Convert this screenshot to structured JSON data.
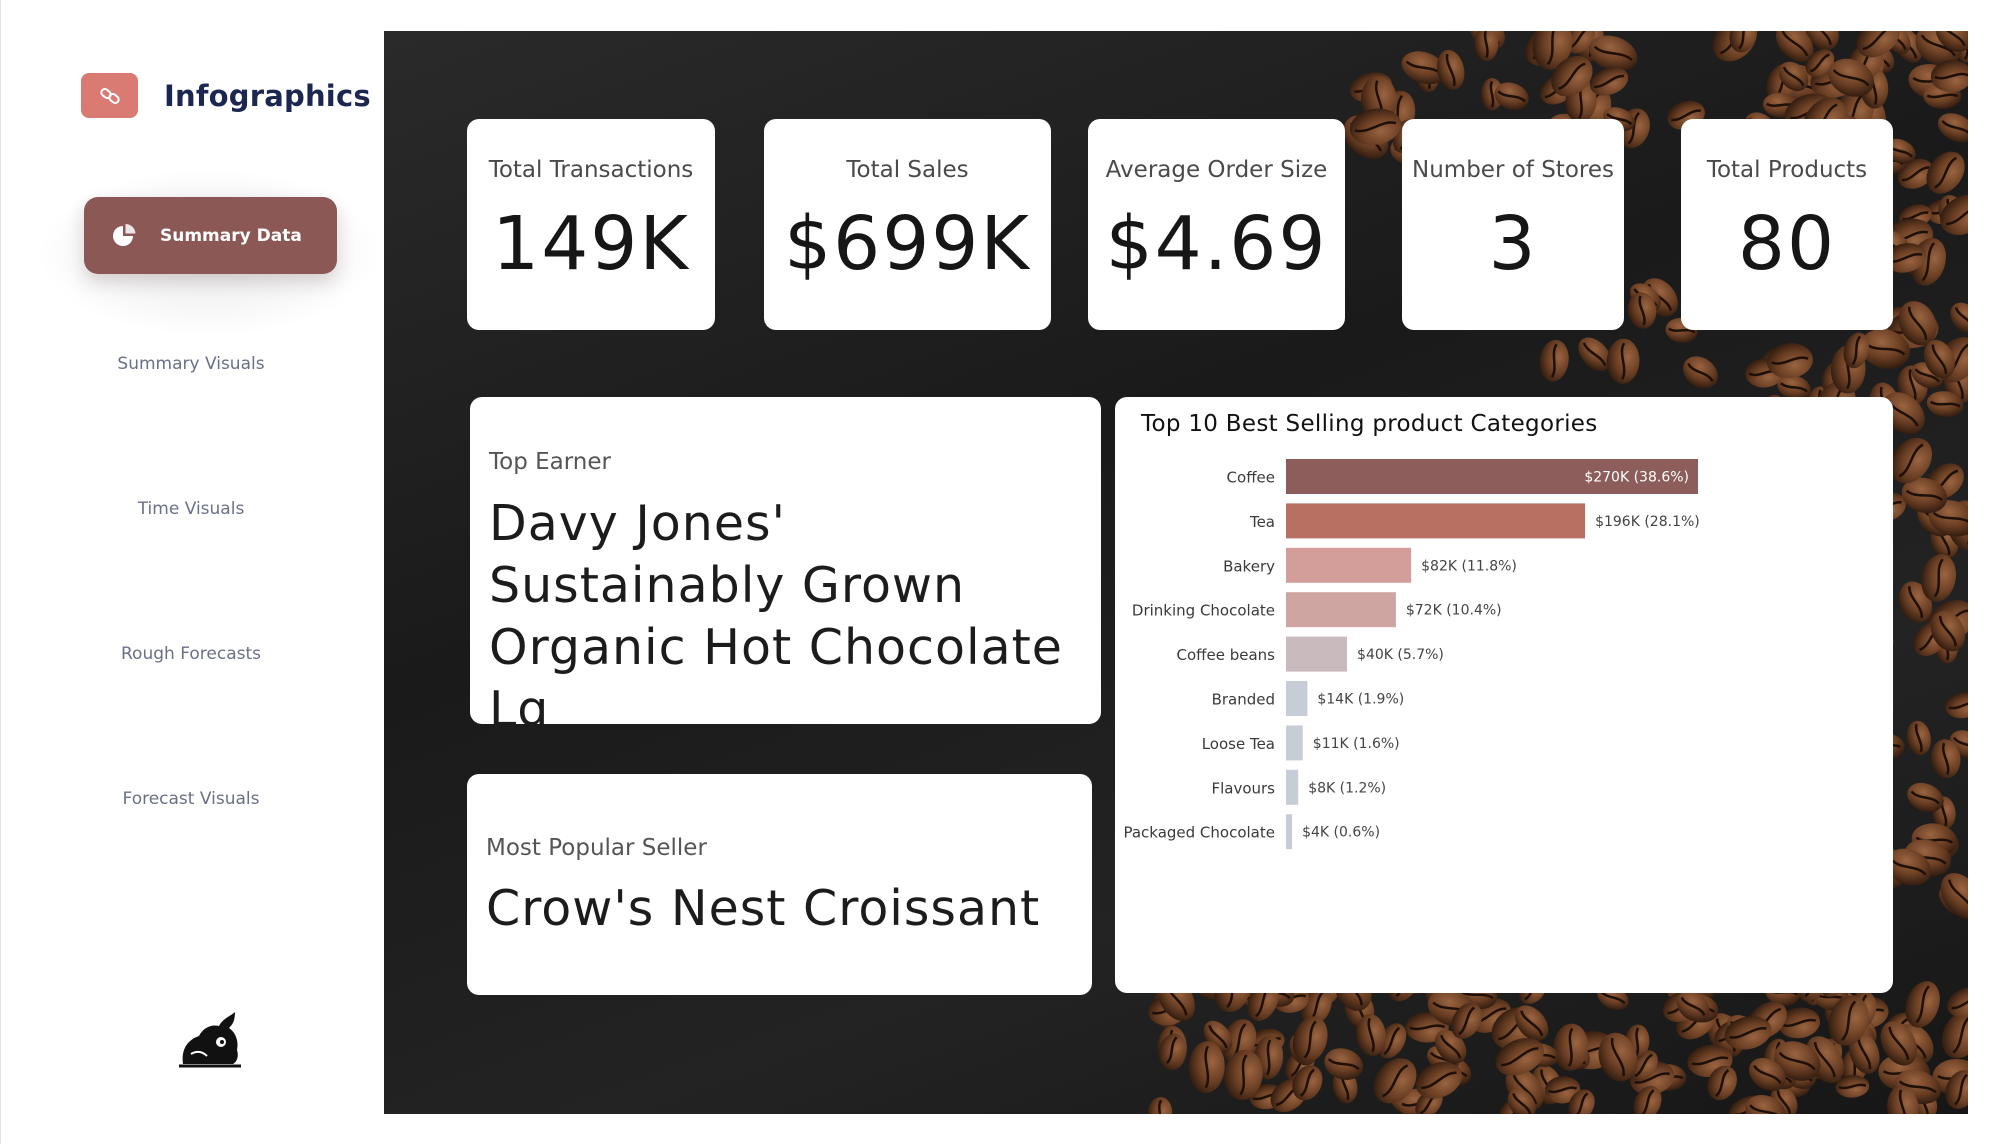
{
  "sidebar": {
    "brand": "Infographics",
    "nav": [
      {
        "label": "Summary Data",
        "active": true
      },
      {
        "label": "Summary Visuals",
        "active": false
      },
      {
        "label": "Time Visuals",
        "active": false
      },
      {
        "label": "Rough Forecasts",
        "active": false
      },
      {
        "label": "Forecast Visuals",
        "active": false
      }
    ]
  },
  "kpis": [
    {
      "label": "Total Transactions",
      "value": "149K"
    },
    {
      "label": "Total Sales",
      "value": "$699K"
    },
    {
      "label": "Average Order Size",
      "value": "$4.69"
    },
    {
      "label": "Number of Stores",
      "value": "3"
    },
    {
      "label": "Total Products",
      "value": "80"
    }
  ],
  "top_earner": {
    "label": "Top Earner",
    "value": "Davy Jones' Sustainably Grown Organic Hot Chocolate Lg"
  },
  "most_popular": {
    "label": "Most Popular Seller",
    "value": "Crow's Nest Croissant"
  },
  "colors": {
    "accent": "#8c5856",
    "brand_badge": "#d97a73",
    "nav_text": "#6a7186",
    "brand_text": "#1b2750"
  },
  "icons": {
    "brand": "link-icon",
    "active_nav": "pie-chart-icon",
    "mascot": "bull-mascot-icon"
  },
  "chart_data": {
    "type": "bar",
    "orientation": "horizontal",
    "title": "Top 10 Best Selling product Categories",
    "categories": [
      "Coffee",
      "Tea",
      "Bakery",
      "Drinking Chocolate",
      "Coffee beans",
      "Branded",
      "Loose Tea",
      "Flavours",
      "Packaged Chocolate"
    ],
    "values": [
      270,
      196,
      82,
      72,
      40,
      14,
      11,
      8,
      4
    ],
    "labels": [
      "$270K (38.6%)",
      "$196K (28.1%)",
      "$82K (11.8%)",
      "$72K (10.4%)",
      "$40K (5.7%)",
      "$14K (1.9%)",
      "$11K (1.6%)",
      "$8K (1.2%)",
      "$4K (0.6%)"
    ],
    "colors": [
      "#8c5d5a",
      "#b87063",
      "#d39e9a",
      "#cfa5a2",
      "#c9babd",
      "#c7cdd6",
      "#c7cdd6",
      "#c7cdd6",
      "#c7cdd6"
    ],
    "xlim": [
      0,
      270
    ],
    "grid": false,
    "legend": "none"
  }
}
